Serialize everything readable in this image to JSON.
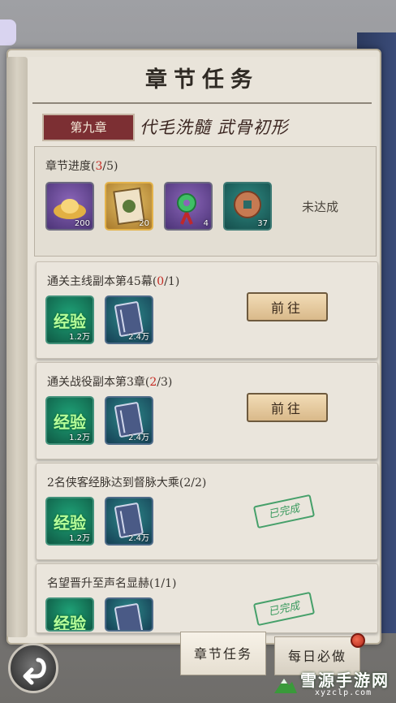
{
  "header": {
    "title": "章节任务"
  },
  "chapter": {
    "tag": "第九章",
    "name": "代毛洗髓 武骨初形"
  },
  "progress": {
    "label": "章节进度(",
    "current": "3",
    "total_suffix": "/5)",
    "status": "未达成",
    "rewards": [
      {
        "icon": "gold-ingot-icon",
        "qty": "200"
      },
      {
        "icon": "scroll-card-icon",
        "qty": "20"
      },
      {
        "icon": "jade-pendant-icon",
        "qty": "4"
      },
      {
        "icon": "coin-icon",
        "qty": "37"
      }
    ]
  },
  "tasks": [
    {
      "title_pre": "通关主线副本第45幕(",
      "cur": "0",
      "title_post": "/1)",
      "exp_label": "经验",
      "exp_qty": "1.2万",
      "book_qty": "2.4万",
      "button": "前往",
      "done": false
    },
    {
      "title_pre": "通关战役副本第3章(",
      "cur": "2",
      "title_post": "/3)",
      "exp_label": "经验",
      "exp_qty": "1.2万",
      "book_qty": "2.4万",
      "button": "前往",
      "done": false
    },
    {
      "title_pre": "2名侠客经脉达到督脉大乘(2/2)",
      "cur": "",
      "title_post": "",
      "exp_label": "经验",
      "exp_qty": "1.2万",
      "book_qty": "2.4万",
      "stamp": "已完成",
      "done": true
    },
    {
      "title_pre": "名望晋升至声名显赫(1/1)",
      "cur": "",
      "title_post": "",
      "exp_label": "经验",
      "exp_qty": "",
      "book_qty": "",
      "stamp": "已完成",
      "done": true
    }
  ],
  "tabs": {
    "chapter_tasks": "章节任务",
    "daily": "每日必做"
  },
  "watermark": {
    "name": "雪源手游网",
    "url": "xyzclp.com"
  },
  "colors": {
    "accent_red": "#c52a22",
    "chapter_tag": "#7c2f33",
    "done_green": "#3a9a5e"
  }
}
